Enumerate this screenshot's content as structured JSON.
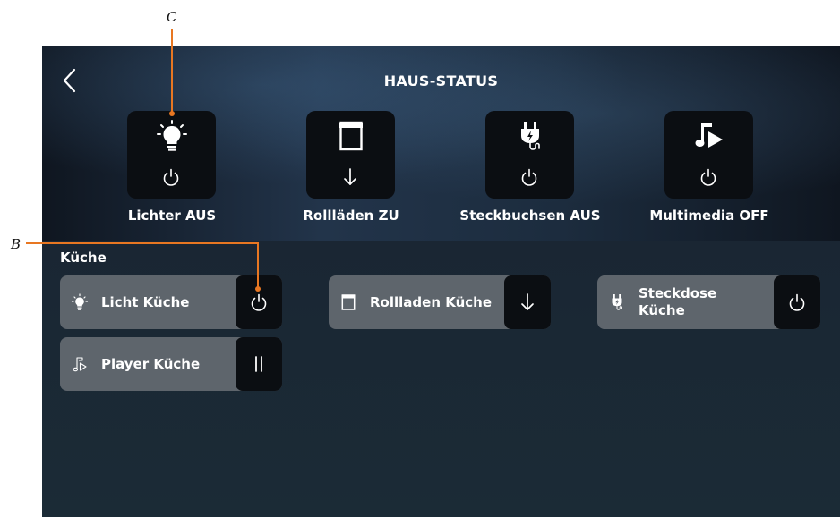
{
  "callouts": {
    "c": "C",
    "b": "B"
  },
  "header": {
    "title": "HAUS-STATUS",
    "back_icon": "chevron-left-icon"
  },
  "status_tiles": [
    {
      "label": "Lichter AUS",
      "icon": "lightbulb-icon",
      "action_icon": "power-icon"
    },
    {
      "label": "Rollläden ZU",
      "icon": "shutter-icon",
      "action_icon": "arrow-down-icon"
    },
    {
      "label": "Steckbuchsen AUS",
      "icon": "plug-icon",
      "action_icon": "power-icon"
    },
    {
      "label": "Multimedia OFF",
      "icon": "music-play-icon",
      "action_icon": "power-icon"
    }
  ],
  "room": {
    "title": "Küche",
    "devices": [
      {
        "label": "Licht Küche",
        "icon": "lightbulb-icon",
        "action_icon": "power-icon"
      },
      {
        "label": "Rollladen Küche",
        "icon": "shutter-icon",
        "action_icon": "arrow-down-icon"
      },
      {
        "label_line1": "Steckdose",
        "label_line2": "Küche",
        "icon": "plug-icon",
        "action_icon": "power-icon"
      },
      {
        "label": "Player Küche",
        "icon": "music-note-icon",
        "action_icon": "pause-icon"
      }
    ]
  },
  "colors": {
    "callout_line": "#e87722",
    "tile_bg": "#0b0e12",
    "card_bg": "#5e656c",
    "text": "#ffffff"
  }
}
